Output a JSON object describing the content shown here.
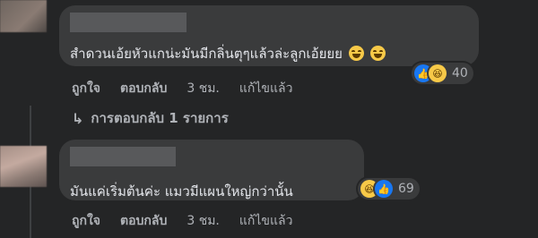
{
  "comments": [
    {
      "text": "สำดวนเอ้ยหัวแกน่ะมันมีกลิ่นตุๆแล้วล่ะลูกเอ้ยยย",
      "reaction_count": "40",
      "actions": {
        "like": "ถูกใจ",
        "reply": "ตอบกลับ",
        "time": "3 ชม.",
        "edited": "แก้ไขแล้ว"
      },
      "replies_link": "การตอบกลับ 1 รายการ"
    },
    {
      "text": "มันแค่เริ่มต้นค่ะ แมวมีแผนใหญ่กว่านั้น",
      "reaction_count": "69",
      "actions": {
        "like": "ถูกใจ",
        "reply": "ตอบกลับ",
        "time": "3 ชม.",
        "edited": "แก้ไขแล้ว"
      }
    }
  ],
  "icons": {
    "reply_arrow": "↳",
    "like": "👍",
    "haha": "😆"
  },
  "colors": {
    "background": "#242526",
    "bubble": "#3a3b3c",
    "like_blue": "#1877f2",
    "emoji_yellow": "#f7c948",
    "secondary_text": "#b0b3b8"
  }
}
